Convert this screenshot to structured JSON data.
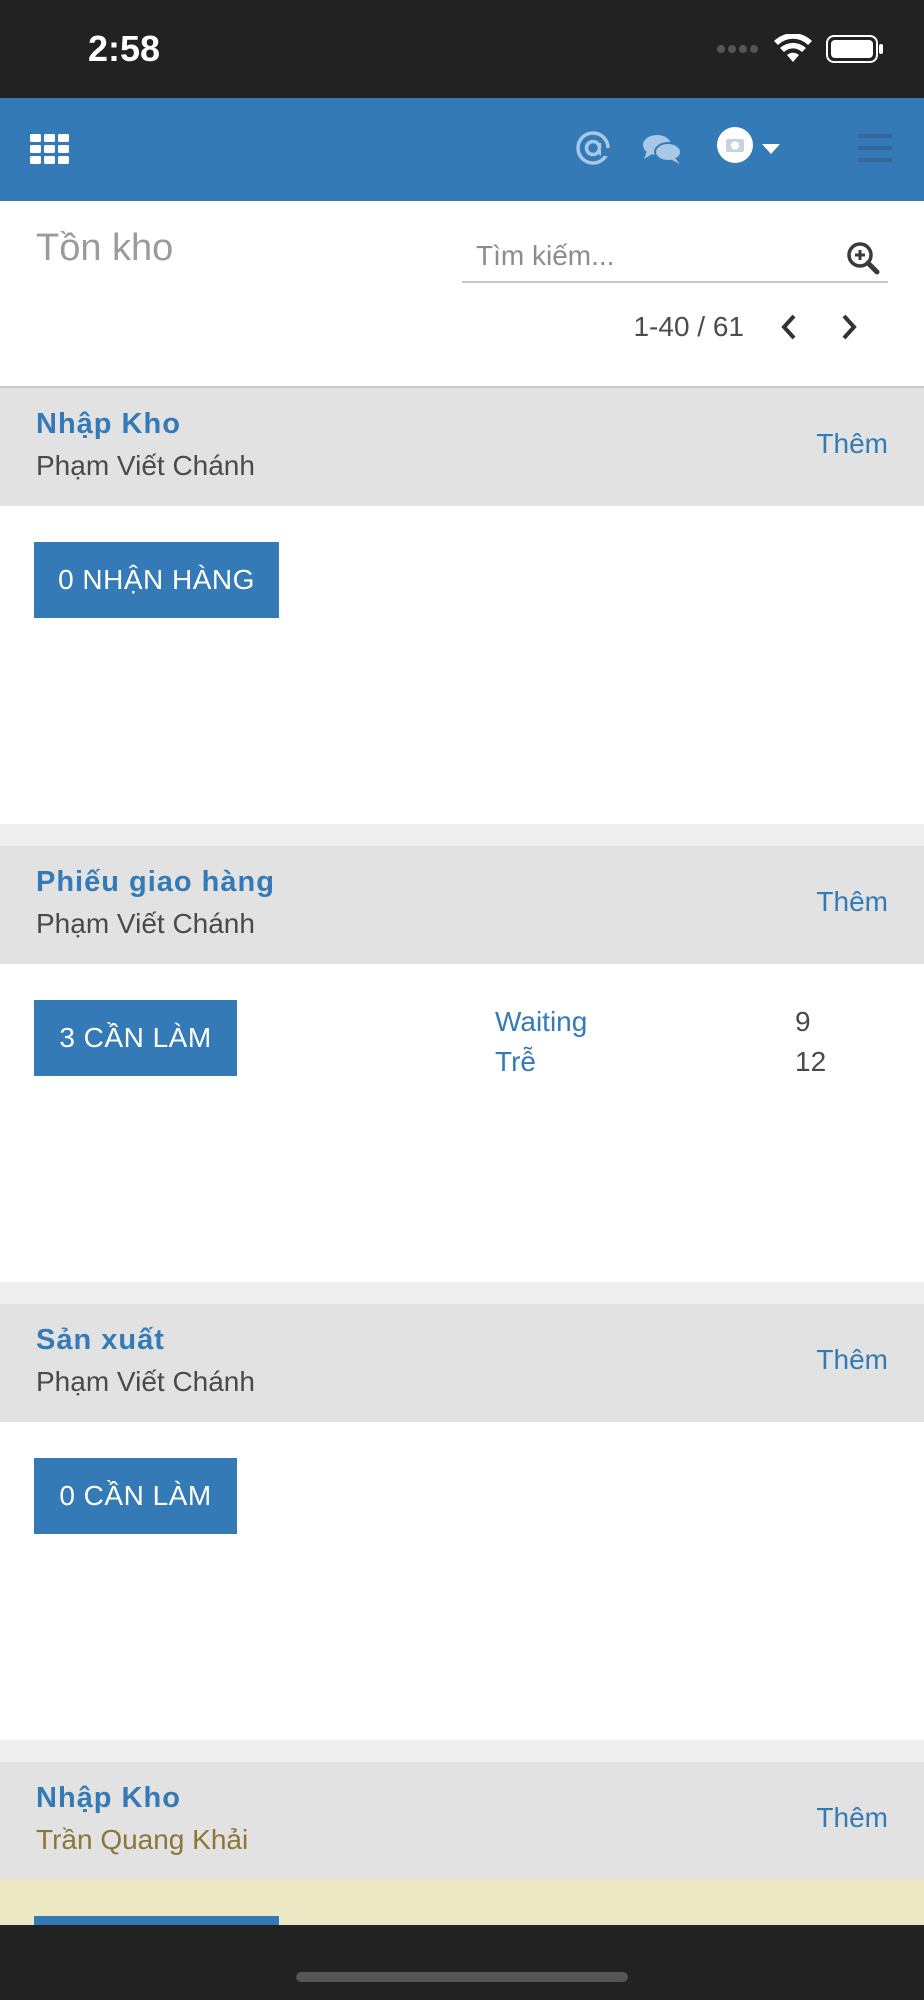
{
  "status_bar": {
    "time": "2:58"
  },
  "control_panel": {
    "title": "Tồn kho",
    "search_placeholder": "Tìm kiếm...",
    "pager_value": "1-40 / 61"
  },
  "cards": [
    {
      "title": "Nhập Kho",
      "subtitle": "Phạm Viết Chánh",
      "more_label": "Thêm",
      "button_label": "0 NHẬN HÀNG"
    },
    {
      "title": "Phiếu giao hàng",
      "subtitle": "Phạm Viết Chánh",
      "more_label": "Thêm",
      "button_label": "3 CẦN LÀM",
      "stats": [
        {
          "label": "Waiting",
          "value": "9"
        },
        {
          "label": "Trễ",
          "value": "12"
        }
      ]
    },
    {
      "title": "Sản xuất",
      "subtitle": "Phạm Viết Chánh",
      "more_label": "Thêm",
      "button_label": "0 CẦN LÀM"
    },
    {
      "title": "Nhập Kho",
      "subtitle": "Trần Quang Khải",
      "more_label": "Thêm"
    }
  ],
  "colors": {
    "brand": "#337ab7",
    "card_header": "#e2e2e2",
    "highlight": "#ede8c4"
  }
}
